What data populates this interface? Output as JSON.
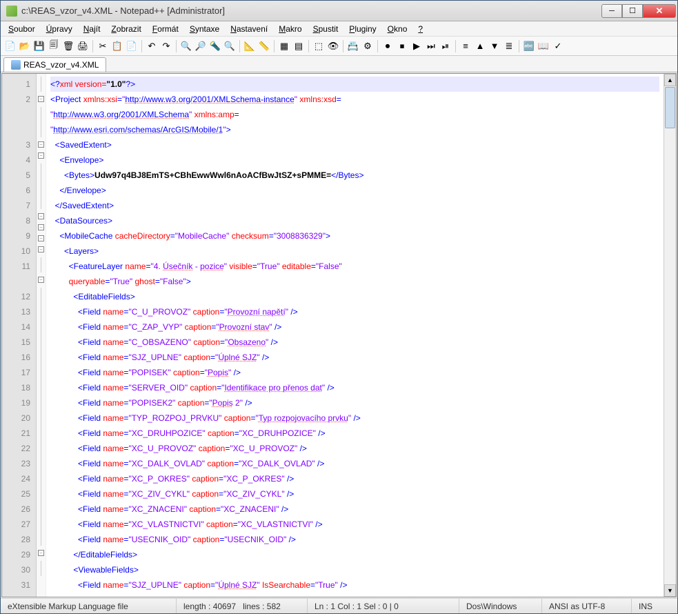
{
  "title": "c:\\REAS_vzor_v4.XML - Notepad++ [Administrator]",
  "menu": [
    "Soubor",
    "Úpravy",
    "Najít",
    "Zobrazit",
    "Formát",
    "Syntaxe",
    "Nastavení",
    "Makro",
    "Spustit",
    "Pluginy",
    "Okno",
    "?"
  ],
  "tab": "REAS_vzor_v4.XML",
  "status": {
    "filetype": "eXtensible Markup Language file",
    "length": "length : 40697",
    "lines": "lines : 582",
    "pos": "Ln : 1   Col : 1   Sel : 0 | 0",
    "eol": "Dos\\Windows",
    "enc": "ANSI as UTF-8",
    "mode": "INS"
  },
  "tool_icons": [
    "📄",
    "📂",
    "💾",
    "🗐",
    "🗑",
    "🖨",
    "",
    "✂",
    "📋",
    "📄",
    "",
    "↶",
    "↷",
    "",
    "🔍",
    "🔎",
    "🔦",
    "🔍",
    "",
    "📐",
    "📏",
    "",
    "▦",
    "▤",
    "",
    "⬚",
    "👁",
    "",
    "📇",
    "⚙",
    "",
    "⏺",
    "⏹",
    "▶",
    "⏭",
    "⏯",
    "",
    "≡",
    "▲",
    "▼",
    "≣",
    "",
    "🔤",
    "📖",
    "✓"
  ],
  "lines": [
    1,
    2,
    "",
    "",
    3,
    4,
    5,
    6,
    7,
    8,
    9,
    10,
    11,
    "",
    12,
    13,
    14,
    15,
    16,
    17,
    18,
    19,
    20,
    21,
    22,
    23,
    24,
    25,
    26,
    27,
    28,
    29,
    30,
    31
  ],
  "fold": [
    "",
    "−",
    "",
    "",
    "−",
    "−",
    "",
    "",
    "",
    "−",
    "−",
    "−",
    "−",
    "",
    "−",
    "",
    "",
    "",
    "",
    "",
    "",
    "",
    "",
    "",
    "",
    "",
    "",
    "",
    "",
    "",
    "",
    "",
    "−",
    ""
  ],
  "code_rows": [
    {
      "hl": true,
      "h": "<span class='t-pi'>&lt;?</span><span class='t-pic'>xml version=</span><span class='t-txt'>\"1.0\"</span><span class='t-pi'>?&gt;</span>"
    },
    {
      "h": "<span class='t-tag'>&lt;Project</span> <span class='t-attr'>xmlns:xsi</span><span class='t-tag'>=</span><span class='t-val'>\"<span class='t-url u'>http://www.w3.org/2001/XMLSchema-instance</span>\"</span> <span class='t-attr'>xmlns:xsd</span><span class='t-tag'>=</span>"
    },
    {
      "h": "<span class='t-val'>\"<span class='t-url u'>http://www.w3.org/2001/XMLSchema</span>\"</span> <span class='t-attr'>xmlns:amp</span><span class='t-tag'>=</span>"
    },
    {
      "h": "<span class='t-val'>\"<span class='t-url u'>http://www.esri.com/schemas/ArcGIS/Mobile/1</span>\"</span><span class='t-tag'>&gt;</span>"
    },
    {
      "h": "  <span class='t-tag'>&lt;SavedExtent&gt;</span>"
    },
    {
      "h": "    <span class='t-tag'>&lt;Envelope&gt;</span>"
    },
    {
      "h": "      <span class='t-tag'>&lt;Bytes&gt;</span><span class='t-txt'>Udw97q4BJ8EmTS+CBhEwwWwl6nAoACfBwJtSZ+sPMME=</span><span class='t-tag'>&lt;/Bytes&gt;</span>"
    },
    {
      "h": "    <span class='t-tag'>&lt;/Envelope&gt;</span>"
    },
    {
      "h": "  <span class='t-tag'>&lt;/SavedExtent&gt;</span>"
    },
    {
      "h": "  <span class='t-tag'>&lt;DataSources&gt;</span>"
    },
    {
      "h": "    <span class='t-tag'>&lt;MobileCache</span> <span class='t-attr'>cacheDirectory</span><span class='t-tag'>=</span><span class='t-val'>\"MobileCache\"</span> <span class='t-attr'>checksum</span><span class='t-tag'>=</span><span class='t-val'>\"3008836329\"</span><span class='t-tag'>&gt;</span>"
    },
    {
      "h": "      <span class='t-tag'>&lt;Layers&gt;</span>"
    },
    {
      "h": "        <span class='t-tag'>&lt;FeatureLayer</span> <span class='t-attr'>name</span><span class='t-tag'>=</span><span class='t-val'>\"4. <span class='u'>Úsečník</span> - <span class='u'>pozice</span>\"</span> <span class='t-attr'>visible</span><span class='t-tag'>=</span><span class='t-val'>\"True\"</span> <span class='t-attr'>editable</span><span class='t-tag'>=</span><span class='t-val'>\"False\"</span>"
    },
    {
      "h": "        <span class='t-attr'>queryable</span><span class='t-tag'>=</span><span class='t-val'>\"True\"</span> <span class='t-attr'>ghost</span><span class='t-tag'>=</span><span class='t-val'>\"False\"</span><span class='t-tag'>&gt;</span>"
    },
    {
      "h": "          <span class='t-tag'>&lt;EditableFields&gt;</span>"
    },
    {
      "h": "            <span class='t-tag'>&lt;Field</span> <span class='t-attr'>name</span><span class='t-tag'>=</span><span class='t-val'>\"C_U_PROVOZ\"</span> <span class='t-attr'>caption</span><span class='t-tag'>=</span><span class='t-val'>\"<span class='u'>Provozní napětí</span>\"</span> <span class='t-tag'>/&gt;</span>"
    },
    {
      "h": "            <span class='t-tag'>&lt;Field</span> <span class='t-attr'>name</span><span class='t-tag'>=</span><span class='t-val'>\"C_ZAP_VYP\"</span> <span class='t-attr'>caption</span><span class='t-tag'>=</span><span class='t-val'>\"<span class='u'>Provozní stav</span>\"</span> <span class='t-tag'>/&gt;</span>"
    },
    {
      "h": "            <span class='t-tag'>&lt;Field</span> <span class='t-attr'>name</span><span class='t-tag'>=</span><span class='t-val'>\"C_OBSAZENO\"</span> <span class='t-attr'>caption</span><span class='t-tag'>=</span><span class='t-val'>\"<span class='u'>Obsazeno</span>\"</span> <span class='t-tag'>/&gt;</span>"
    },
    {
      "h": "            <span class='t-tag'>&lt;Field</span> <span class='t-attr'>name</span><span class='t-tag'>=</span><span class='t-val'>\"SJZ_UPLNE\"</span> <span class='t-attr'>caption</span><span class='t-tag'>=</span><span class='t-val'>\"<span class='u'>Úplné SJZ</span>\"</span> <span class='t-tag'>/&gt;</span>"
    },
    {
      "h": "            <span class='t-tag'>&lt;Field</span> <span class='t-attr'>name</span><span class='t-tag'>=</span><span class='t-val'>\"POPISEK\"</span> <span class='t-attr'>caption</span><span class='t-tag'>=</span><span class='t-val'>\"<span class='u'>Popis</span>\"</span> <span class='t-tag'>/&gt;</span>"
    },
    {
      "h": "            <span class='t-tag'>&lt;Field</span> <span class='t-attr'>name</span><span class='t-tag'>=</span><span class='t-val'>\"SERVER_OID\"</span> <span class='t-attr'>caption</span><span class='t-tag'>=</span><span class='t-val'>\"<span class='u'>Identifikace pro přenos dat</span>\"</span> <span class='t-tag'>/&gt;</span>"
    },
    {
      "h": "            <span class='t-tag'>&lt;Field</span> <span class='t-attr'>name</span><span class='t-tag'>=</span><span class='t-val'>\"POPISEK2\"</span> <span class='t-attr'>caption</span><span class='t-tag'>=</span><span class='t-val'>\"<span class='u'>Popis</span> 2\"</span> <span class='t-tag'>/&gt;</span>"
    },
    {
      "h": "            <span class='t-tag'>&lt;Field</span> <span class='t-attr'>name</span><span class='t-tag'>=</span><span class='t-val'>\"TYP_ROZPOJ_PRVKU\"</span> <span class='t-attr'>caption</span><span class='t-tag'>=</span><span class='t-val'>\"<span class='u'>Typ rozpojovacího prvku</span>\"</span> <span class='t-tag'>/&gt;</span>"
    },
    {
      "h": "            <span class='t-tag'>&lt;Field</span> <span class='t-attr'>name</span><span class='t-tag'>=</span><span class='t-val'>\"XC_DRUHPOZICE\"</span> <span class='t-attr'>caption</span><span class='t-tag'>=</span><span class='t-val'>\"XC_DRUHPOZICE\"</span> <span class='t-tag'>/&gt;</span>"
    },
    {
      "h": "            <span class='t-tag'>&lt;Field</span> <span class='t-attr'>name</span><span class='t-tag'>=</span><span class='t-val'>\"XC_U_PROVOZ\"</span> <span class='t-attr'>caption</span><span class='t-tag'>=</span><span class='t-val'>\"XC_U_PROVOZ\"</span> <span class='t-tag'>/&gt;</span>"
    },
    {
      "h": "            <span class='t-tag'>&lt;Field</span> <span class='t-attr'>name</span><span class='t-tag'>=</span><span class='t-val'>\"XC_DALK_OVLAD\"</span> <span class='t-attr'>caption</span><span class='t-tag'>=</span><span class='t-val'>\"XC_DALK_OVLAD\"</span> <span class='t-tag'>/&gt;</span>"
    },
    {
      "h": "            <span class='t-tag'>&lt;Field</span> <span class='t-attr'>name</span><span class='t-tag'>=</span><span class='t-val'>\"XC_P_OKRES\"</span> <span class='t-attr'>caption</span><span class='t-tag'>=</span><span class='t-val'>\"XC_P_OKRES\"</span> <span class='t-tag'>/&gt;</span>"
    },
    {
      "h": "            <span class='t-tag'>&lt;Field</span> <span class='t-attr'>name</span><span class='t-tag'>=</span><span class='t-val'>\"XC_ZIV_CYKL\"</span> <span class='t-attr'>caption</span><span class='t-tag'>=</span><span class='t-val'>\"XC_ZIV_CYKL\"</span> <span class='t-tag'>/&gt;</span>"
    },
    {
      "h": "            <span class='t-tag'>&lt;Field</span> <span class='t-attr'>name</span><span class='t-tag'>=</span><span class='t-val'>\"XC_ZNACENI\"</span> <span class='t-attr'>caption</span><span class='t-tag'>=</span><span class='t-val'>\"XC_ZNACENI\"</span> <span class='t-tag'>/&gt;</span>"
    },
    {
      "h": "            <span class='t-tag'>&lt;Field</span> <span class='t-attr'>name</span><span class='t-tag'>=</span><span class='t-val'>\"XC_VLASTNICTVI\"</span> <span class='t-attr'>caption</span><span class='t-tag'>=</span><span class='t-val'>\"XC_VLASTNICTVI\"</span> <span class='t-tag'>/&gt;</span>"
    },
    {
      "h": "            <span class='t-tag'>&lt;Field</span> <span class='t-attr'>name</span><span class='t-tag'>=</span><span class='t-val'>\"USECNIK_OID\"</span> <span class='t-attr'>caption</span><span class='t-tag'>=</span><span class='t-val'>\"USECNIK_OID\"</span> <span class='t-tag'>/&gt;</span>"
    },
    {
      "h": "          <span class='t-tag'>&lt;/EditableFields&gt;</span>"
    },
    {
      "h": "          <span class='t-tag'>&lt;ViewableFields&gt;</span>"
    },
    {
      "h": "            <span class='t-tag'>&lt;Field</span> <span class='t-attr'>name</span><span class='t-tag'>=</span><span class='t-val'>\"SJZ_UPLNE\"</span> <span class='t-attr'>caption</span><span class='t-tag'>=</span><span class='t-val'>\"<span class='u'>Úplné SJZ</span>\"</span> <span class='t-attr'>IsSearchable</span><span class='t-tag'>=</span><span class='t-val'>\"True\"</span> <span class='t-tag'>/&gt;</span>"
    }
  ]
}
